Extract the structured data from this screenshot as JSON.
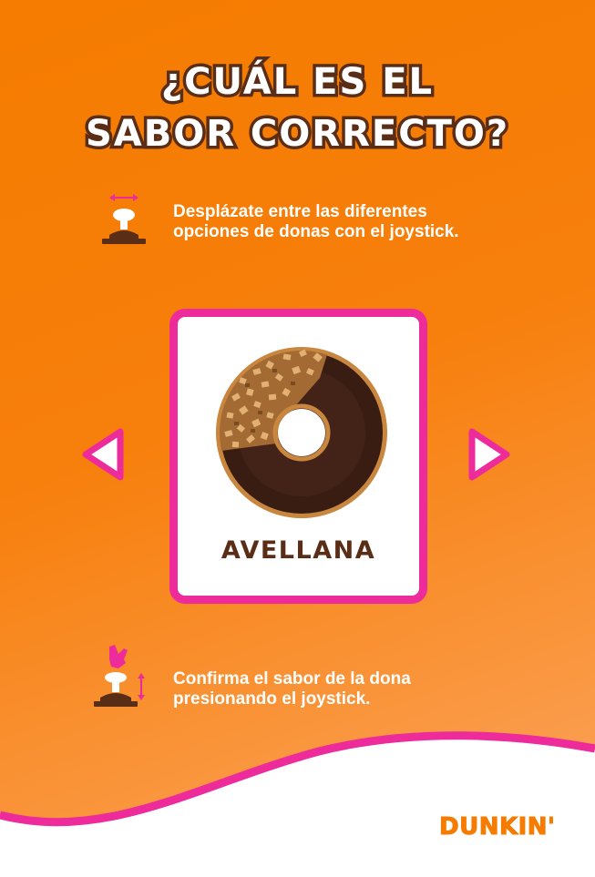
{
  "title": {
    "line1": "¿Cuál es el",
    "line2": "sabor correcto?"
  },
  "instructions": {
    "navigate": {
      "line1": "Desplázate entre las diferentes",
      "line2": "opciones de donas con el joystick."
    },
    "confirm": {
      "line1": "Confirma el sabor de la dona",
      "line2": "presionando el joystick."
    }
  },
  "card": {
    "flavor": "AVELLANA",
    "image": "chocolate-hazelnut-donut"
  },
  "brand": {
    "logo": "DUNKIN'"
  },
  "icons": {
    "navigate": "joystick-move-icon",
    "confirm": "joystick-press-icon",
    "prev": "arrow-left-icon",
    "next": "arrow-right-icon"
  },
  "colors": {
    "accent": "#ee2b9b",
    "brown": "#5a2d17",
    "orange": "#f57c00",
    "white": "#ffffff"
  }
}
